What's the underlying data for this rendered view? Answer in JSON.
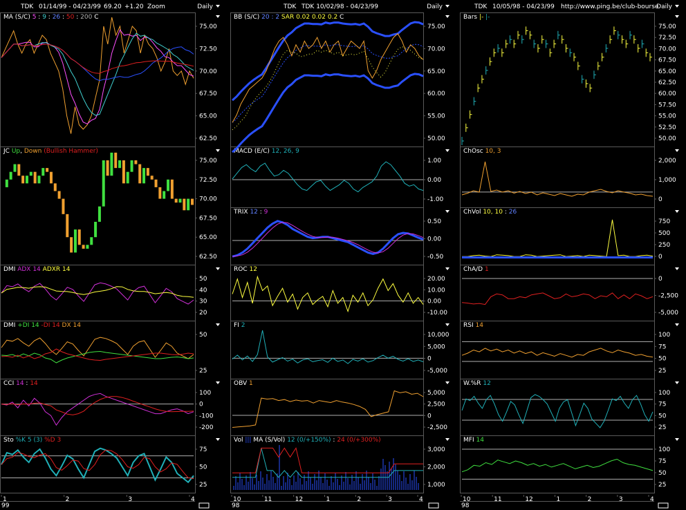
{
  "colors": {
    "bg": "#000000",
    "frame": "#5a5a5a",
    "text": "#ffffff",
    "orange": "#f0a030",
    "yellow": "#ffff40",
    "cyan": "#20b0b8",
    "blue": "#2a50ff",
    "red": "#e02020",
    "magenta": "#d030d8",
    "green": "#40e040",
    "gray": "#b0b0b0"
  },
  "columns": [
    {
      "header": {
        "symbol": "TDK",
        "range": "01/14/99 - 04/23/99",
        "price": "69.20",
        "change": "+1.20",
        "extra": "Zoom",
        "period": "Daily"
      },
      "x_ticks": [
        "1",
        "2",
        "3",
        "4"
      ],
      "year_label": "99",
      "panels": [
        {
          "id": "ma",
          "title": [
            {
              "t": "MA (S/C)",
              "c": "#ffffff"
            },
            {
              "t": " 5",
              "c": "#ff50ff"
            },
            {
              "t": " : ",
              "c": "#ffffff"
            },
            {
              "t": "9",
              "c": "#40d0d0"
            },
            {
              "t": " : ",
              "c": "#ffffff"
            },
            {
              "t": "26",
              "c": "#6080ff"
            },
            {
              "t": " : ",
              "c": "#ffffff"
            },
            {
              "t": "50",
              "c": "#e02020"
            },
            {
              "t": " : ",
              "c": "#ffffff"
            },
            {
              "t": "200",
              "c": "#b0b0b0"
            },
            {
              "t": "   C",
              "c": "#ffffff"
            }
          ],
          "yticks": [
            "75.00",
            "72.50",
            "70.00",
            "67.50",
            "65.00",
            "62.50"
          ]
        },
        {
          "id": "jc",
          "title": [
            {
              "t": "JC ",
              "c": "#ffffff"
            },
            {
              "t": "Up",
              "c": "#40e040"
            },
            {
              "t": ", ",
              "c": "#ffffff"
            },
            {
              "t": "Down",
              "c": "#f0a030"
            },
            {
              "t": " (Bullish Hammer)",
              "c": "#e02020"
            }
          ],
          "yticks": [
            "75.00",
            "72.50",
            "70.00",
            "67.50",
            "65.00",
            "62.50"
          ]
        },
        {
          "id": "dmi1",
          "title": [
            {
              "t": "DMI ",
              "c": "#ffffff"
            },
            {
              "t": "ADX 14",
              "c": "#d030d8"
            },
            {
              "t": " ADXR 14",
              "c": "#ffff40"
            }
          ],
          "yticks": [
            "50",
            "40",
            "30",
            "20"
          ]
        },
        {
          "id": "dmi2",
          "title": [
            {
              "t": "DMI ",
              "c": "#ffffff"
            },
            {
              "t": "+DI 14",
              "c": "#40e040"
            },
            {
              "t": " -DI 14",
              "c": "#e02020"
            },
            {
              "t": " DX 14",
              "c": "#f0a030"
            }
          ],
          "yticks": [
            "50",
            "25"
          ]
        },
        {
          "id": "cci",
          "title": [
            {
              "t": "CCI ",
              "c": "#ffffff"
            },
            {
              "t": "14",
              "c": "#d030d8"
            },
            {
              "t": " : ",
              "c": "#ffffff"
            },
            {
              "t": "14",
              "c": "#e02020"
            }
          ],
          "yticks": [
            "100",
            "0",
            "-100",
            "-200"
          ]
        },
        {
          "id": "sto",
          "title": [
            {
              "t": "Sto ",
              "c": "#ffffff"
            },
            {
              "t": "%K 5 (3)",
              "c": "#20b0b8"
            },
            {
              "t": " %D 3",
              "c": "#e02020"
            }
          ],
          "yticks": [
            "75",
            "50",
            "25"
          ]
        }
      ]
    },
    {
      "header": {
        "symbol": "TDK",
        "range": "TDK  10/02/98 - 04/23/99",
        "price": "",
        "change": "",
        "extra": "",
        "period": "Daily"
      },
      "x_ticks": [
        "10",
        "11",
        "12",
        "1",
        "2",
        "3",
        "4"
      ],
      "year_label": "98",
      "panels": [
        {
          "id": "bb",
          "title": [
            {
              "t": "BB (S/C)",
              "c": "#ffffff"
            },
            {
              "t": " 20 : 2",
              "c": "#6080ff"
            },
            {
              "t": "   SAR  0.02  0.02  0.2",
              "c": "#ffff40"
            },
            {
              "t": "   C",
              "c": "#ffffff"
            }
          ],
          "yticks": [
            "75.00",
            "70.00",
            "65.00",
            "60.00",
            "55.00",
            "50.00"
          ]
        },
        {
          "id": "macd",
          "title": [
            {
              "t": "MACD (E/C)",
              "c": "#ffffff"
            },
            {
              "t": " 12, 26, 9",
              "c": "#20b0b8"
            }
          ],
          "yticks": [
            "1.00",
            "0.00",
            "-1.00"
          ]
        },
        {
          "id": "trix",
          "title": [
            {
              "t": "TRIX ",
              "c": "#ffffff"
            },
            {
              "t": " 12",
              "c": "#6080ff"
            },
            {
              "t": " : ",
              "c": "#ffffff"
            },
            {
              "t": "9",
              "c": "#d030d8"
            }
          ],
          "yticks": [
            "0.50",
            "0.00",
            "-0.50"
          ]
        },
        {
          "id": "roc",
          "title": [
            {
              "t": "ROC ",
              "c": "#ffffff"
            },
            {
              "t": " 12",
              "c": "#ffff40"
            }
          ],
          "yticks": [
            "20.00",
            "10.00",
            "0.00",
            "-10.00"
          ]
        },
        {
          "id": "fi",
          "title": [
            {
              "t": "FI ",
              "c": "#ffffff"
            },
            {
              "t": " 2",
              "c": "#20b0b8"
            }
          ],
          "yticks": [
            "10,000",
            "5,000",
            "0",
            "-5,000"
          ]
        },
        {
          "id": "obv",
          "title": [
            {
              "t": "OBV ",
              "c": "#ffffff"
            },
            {
              "t": " 1",
              "c": "#f0a030"
            }
          ],
          "yticks": [
            "5,000",
            "2,500",
            "0",
            "-2,500"
          ]
        },
        {
          "id": "vol",
          "title": [
            {
              "t": "Vol ",
              "c": "#ffffff"
            },
            {
              "t": " |||",
              "c": "#2a50ff"
            },
            {
              "t": "   MA (S/Vol)",
              "c": "#ffffff"
            },
            {
              "t": " 12 (0/+150%)",
              "c": "#20b0b8"
            },
            {
              "t": " : ",
              "c": "#ffffff"
            },
            {
              "t": "24 (0/+300%)",
              "c": "#e02020"
            }
          ],
          "yticks": [
            "3,000",
            "2,000",
            "1,000"
          ]
        }
      ]
    },
    {
      "header": {
        "symbol": "TDK",
        "range": "10/05/98 - 04/23/99",
        "price": "",
        "change": "",
        "extra": "http://www.ping.be/club-bourse",
        "period": "Daily"
      },
      "x_ticks": [
        "10",
        "11",
        "12",
        "1",
        "2",
        "3",
        "4"
      ],
      "year_label": "98",
      "panels": [
        {
          "id": "bars",
          "title": [
            {
              "t": "Bars ",
              "c": "#ffffff"
            },
            {
              "t": " |-",
              "c": "#ffff40"
            },
            {
              "t": "  |-",
              "c": "#20b0b8"
            }
          ],
          "yticks": [
            "75.00",
            "72.50",
            "70.00",
            "67.50",
            "65.00",
            "62.50",
            "60.00",
            "57.50",
            "55.00",
            "52.50",
            "50.00"
          ]
        },
        {
          "id": "chosc",
          "title": [
            {
              "t": "ChOsc ",
              "c": "#ffffff"
            },
            {
              "t": " 10, 3",
              "c": "#f0a030"
            }
          ],
          "yticks": [
            "2,000",
            "1,000",
            "0"
          ]
        },
        {
          "id": "chvol",
          "title": [
            {
              "t": "ChVol ",
              "c": "#ffffff"
            },
            {
              "t": " 10, 10",
              "c": "#ffff40"
            },
            {
              "t": " : ",
              "c": "#ffffff"
            },
            {
              "t": "26",
              "c": "#6080ff"
            }
          ],
          "yticks": [
            "750",
            "500",
            "250",
            "0"
          ]
        },
        {
          "id": "chad",
          "title": [
            {
              "t": "ChA/D ",
              "c": "#ffffff"
            },
            {
              "t": " 1",
              "c": "#e02020"
            }
          ],
          "yticks": [
            "0",
            "-2,500",
            "-5,000"
          ]
        },
        {
          "id": "rsi",
          "title": [
            {
              "t": "RSI ",
              "c": "#ffffff"
            },
            {
              "t": " 14",
              "c": "#f0a030"
            }
          ],
          "yticks": [
            "100",
            "75",
            "50",
            "25"
          ]
        },
        {
          "id": "wr",
          "title": [
            {
              "t": "W.%R ",
              "c": "#ffffff"
            },
            {
              "t": " 12",
              "c": "#20b0b8"
            }
          ],
          "yticks": [
            "100",
            "75",
            "50",
            "25"
          ]
        },
        {
          "id": "mfi",
          "title": [
            {
              "t": "MFI ",
              "c": "#ffffff"
            },
            {
              "t": " 14",
              "c": "#40e040"
            }
          ],
          "yticks": [
            "100",
            "75",
            "50",
            "25"
          ]
        }
      ]
    }
  ],
  "chart_data": {
    "type": "line",
    "ma_close": [
      71.5,
      72.5,
      73.5,
      74.5,
      73.0,
      72.0,
      73.0,
      73.5,
      72.0,
      73.0,
      74.0,
      73.5,
      72.0,
      71.0,
      70.0,
      68.0,
      65.0,
      63.0,
      66.0,
      64.0,
      63.5,
      64.0,
      65.0,
      67.0,
      69.0,
      75.0,
      73.0,
      76.0,
      74.0,
      75.0,
      72.0,
      73.5,
      75.0,
      74.5,
      72.0,
      74.0,
      73.0,
      72.5,
      71.5,
      70.0,
      71.0,
      72.5,
      70.0,
      69.5,
      70.0,
      68.5,
      70.0,
      69.2
    ],
    "bb_close": [
      52,
      54,
      57,
      59,
      61,
      62,
      63,
      64,
      66,
      69,
      72,
      74,
      75,
      73,
      70,
      73,
      71,
      74,
      72,
      73,
      75,
      72,
      74,
      71,
      73,
      74,
      70,
      72,
      74,
      73,
      72,
      74,
      66,
      64,
      66,
      69,
      71,
      73,
      75,
      76,
      74,
      71,
      73,
      72,
      70,
      69
    ],
    "bars_close": [
      50,
      53,
      56,
      59,
      62,
      64,
      66,
      68,
      70,
      71,
      70,
      72,
      73,
      72,
      74,
      73,
      75,
      74,
      72,
      71,
      73,
      72,
      70,
      72,
      74,
      73,
      71,
      70,
      69,
      67,
      64,
      63,
      62,
      65,
      67,
      69,
      71,
      73,
      75,
      74,
      73,
      72,
      74,
      73,
      71,
      72,
      70,
      69
    ],
    "macd": [
      0.2,
      0.6,
      1.0,
      1.2,
      0.9,
      0.7,
      1.1,
      1.3,
      0.8,
      0.4,
      0.5,
      0.8,
      0.6,
      0.2,
      -0.2,
      -0.5,
      -0.6,
      -0.3,
      0.0,
      0.1,
      -0.3,
      -0.6,
      -0.4,
      -0.2,
      0.1,
      -0.1,
      -0.5,
      -0.7,
      -0.4,
      -0.2,
      0.0,
      0.4,
      1.1,
      1.4,
      1.2,
      0.8,
      0.4,
      -0.1,
      -0.3,
      -0.2,
      -0.5,
      -0.6
    ],
    "trix": [
      -0.6,
      -0.55,
      -0.45,
      -0.3,
      -0.1,
      0.1,
      0.3,
      0.5,
      0.65,
      0.75,
      0.7,
      0.6,
      0.45,
      0.35,
      0.25,
      0.15,
      0.1,
      0.12,
      0.15,
      0.15,
      0.1,
      0.05,
      0.0,
      -0.05,
      -0.15,
      -0.25,
      -0.35,
      -0.45,
      -0.5,
      -0.45,
      -0.3,
      -0.1,
      0.1,
      0.25,
      0.3,
      0.28,
      0.2,
      0.12,
      0.05
    ],
    "roc": [
      5,
      18,
      2,
      15,
      -3,
      20,
      8,
      12,
      -5,
      3,
      10,
      -2,
      5,
      -8,
      2,
      6,
      -4,
      0,
      3,
      -6,
      8,
      -3,
      2,
      -10,
      4,
      -2,
      6,
      -5,
      0,
      10,
      18,
      8,
      14,
      4,
      -2,
      6,
      -3,
      2,
      -4
    ],
    "obv": [
      -2500,
      -2400,
      -2300,
      -2200,
      -2000,
      3500,
      3300,
      3400,
      3000,
      3200,
      2800,
      3100,
      2900,
      3000,
      2500,
      3000,
      2800,
      2600,
      3000,
      2700,
      2500,
      2200,
      1800,
      1200,
      -300,
      100,
      400,
      700,
      5000,
      4600,
      4800,
      4300,
      4500,
      3800
    ],
    "rsi": [
      50,
      55,
      62,
      58,
      66,
      60,
      64,
      58,
      62,
      55,
      60,
      54,
      58,
      50,
      56,
      52,
      48,
      54,
      50,
      46,
      52,
      50,
      58,
      62,
      66,
      60,
      56,
      62,
      58,
      55,
      50,
      52,
      48,
      46
    ],
    "mfi": [
      45,
      50,
      60,
      58,
      66,
      62,
      72,
      68,
      64,
      70,
      66,
      60,
      64,
      58,
      62,
      56,
      60,
      64,
      58,
      52,
      56,
      60,
      55,
      58,
      64,
      70,
      74,
      66,
      62,
      60,
      56,
      52,
      48
    ],
    "sto_k": [
      55,
      82,
      78,
      88,
      72,
      60,
      80,
      90,
      70,
      45,
      30,
      52,
      76,
      68,
      45,
      25,
      55,
      85,
      92,
      88,
      80,
      70,
      50,
      30,
      60,
      75,
      80,
      50,
      20,
      45,
      72,
      60,
      35,
      25,
      15,
      30
    ],
    "cci": [
      20,
      10,
      40,
      -20,
      60,
      0,
      80,
      30,
      -60,
      -100,
      -200,
      -120,
      -60,
      -20,
      20,
      60,
      100,
      120,
      130,
      100,
      80,
      60,
      40,
      20,
      0,
      -20,
      -40,
      -60,
      -80,
      -80,
      -60,
      -40,
      -30,
      -50,
      -80,
      -60
    ]
  }
}
